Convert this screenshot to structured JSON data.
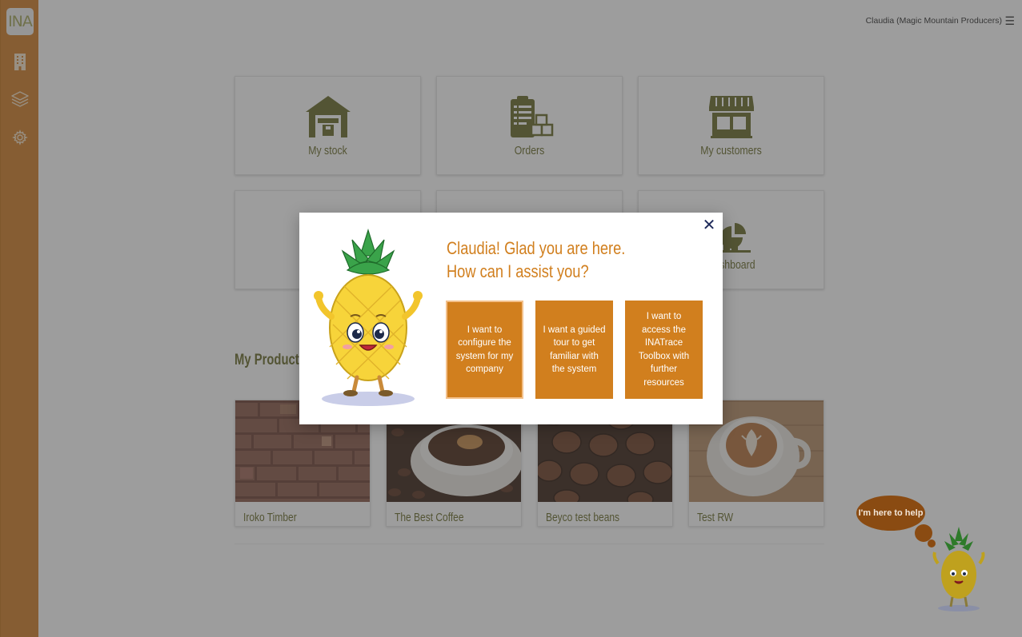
{
  "sidebar": {
    "logo": "INA",
    "items": [
      {
        "icon": "building-icon"
      },
      {
        "icon": "layers-icon"
      },
      {
        "icon": "gear-icon"
      }
    ]
  },
  "header": {
    "user": "Claudia (Magic Mountain Producers)",
    "menu_icon": "hamburger-icon"
  },
  "tiles": [
    {
      "label": "My stock",
      "icon": "warehouse-icon"
    },
    {
      "label": "Orders",
      "icon": "clipboard-boxes-icon"
    },
    {
      "label": "My customers",
      "icon": "store-icon"
    },
    {
      "label": "",
      "icon": "unknown-icon"
    },
    {
      "label": "",
      "icon": "unknown-icon"
    },
    {
      "label": "Dashboard",
      "icon": "chart-icon"
    }
  ],
  "products": {
    "title": "My Products",
    "items": [
      {
        "name": "Iroko Timber"
      },
      {
        "name": "The Best Coffee"
      },
      {
        "name": "Beyco test beans"
      },
      {
        "name": "Test RW"
      }
    ]
  },
  "modal": {
    "title_line1": "Claudia! Glad you are here.",
    "title_line2": "How can I assist you?",
    "close_icon": "close-icon",
    "options": [
      {
        "label": "I want to configure the system for my company"
      },
      {
        "label": "I want a guided tour to get familiar with the system"
      },
      {
        "label": "I want to access the INATrace Toolbox with further resources"
      }
    ]
  },
  "help": {
    "bubble": "I'm here to help"
  },
  "colors": {
    "sidebar": "#d17f2a",
    "accent": "#d17f1e",
    "olive": "#6b6d2c",
    "bubble": "#8a4b12"
  }
}
